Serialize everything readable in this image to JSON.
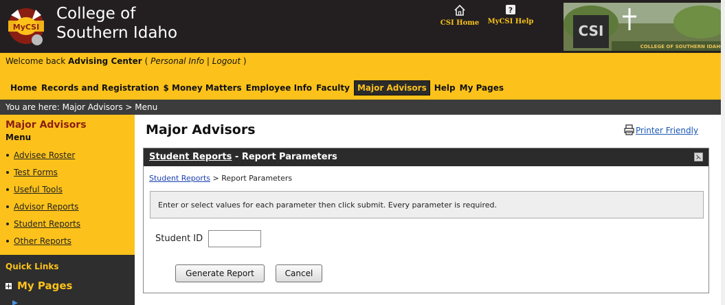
{
  "header": {
    "logo_text": "MyCSI",
    "college_name_line1": "College of",
    "college_name_line2": "Southern Idaho",
    "links": [
      {
        "label": "CSI Home",
        "icon": "home-icon"
      },
      {
        "label": "MyCSI Help",
        "icon": "help-icon"
      }
    ],
    "banner_logo": "CSI",
    "banner_caption": "COLLEGE OF SOUTHERN IDAHO"
  },
  "welcome": {
    "prefix": "Welcome back",
    "user": "Advising Center",
    "open_paren": "(",
    "personal_info": "Personal Info",
    "separator": "|",
    "logout": "Logout",
    "close_paren": ")"
  },
  "nav": {
    "items": [
      {
        "label": "Home"
      },
      {
        "label": "Records and Registration"
      },
      {
        "label": "$ Money Matters"
      },
      {
        "label": "Employee Info"
      },
      {
        "label": "Faculty"
      },
      {
        "label": "Major Advisors",
        "active": true
      },
      {
        "label": "Help"
      },
      {
        "label": "My Pages"
      }
    ]
  },
  "breadcrumb": {
    "text": "You are here:  Major Advisors > Menu"
  },
  "sidebar": {
    "title": "Major Advisors",
    "menu_label": "Menu",
    "items": [
      {
        "label": "Advisee Roster"
      },
      {
        "label": "Test Forms"
      },
      {
        "label": "Useful Tools"
      },
      {
        "label": "Advisor Reports"
      },
      {
        "label": "Student Reports"
      },
      {
        "label": "Other Reports"
      }
    ],
    "quick_links": "Quick Links",
    "my_pages": "My Pages"
  },
  "main": {
    "title": "Major Advisors",
    "printer_friendly": "Printer Friendly",
    "panel": {
      "head_link": "Student Reports",
      "head_rest": " - Report Parameters",
      "crumb_link": "Student Reports",
      "crumb_rest": " > Report Parameters",
      "instructions": "Enter or select values for each parameter then click submit. Every parameter is required.",
      "student_id_label": "Student ID",
      "student_id_value": "",
      "generate_label": "Generate Report",
      "cancel_label": "Cancel"
    }
  },
  "colors": {
    "gold": "#fcc21b",
    "dark": "#231f20",
    "maroon": "#8b1e12",
    "link_blue": "#1a56b5"
  }
}
